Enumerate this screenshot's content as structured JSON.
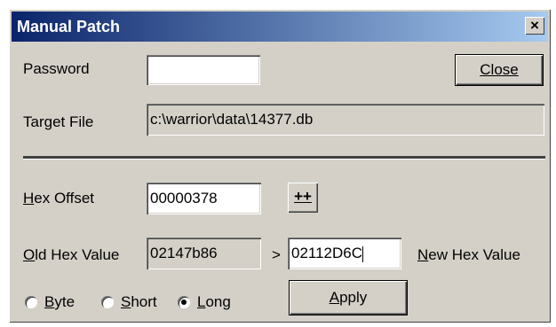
{
  "window": {
    "title": "Manual Patch",
    "close_glyph": "×"
  },
  "password": {
    "label": "Password",
    "value": ""
  },
  "close_button": {
    "label": "Close"
  },
  "target_file": {
    "label": "Target File",
    "value": "c:\\warrior\\data\\14377.db"
  },
  "hex_offset": {
    "label_first": "H",
    "label_rest": "ex Offset",
    "value": "00000378"
  },
  "increment_button": {
    "label": "++"
  },
  "old_hex": {
    "label_first": "O",
    "label_rest": "ld Hex Value",
    "value": "02147b86"
  },
  "arrow": ">",
  "new_hex": {
    "value": "02112D6C",
    "label_first": "N",
    "label_rest": "ew Hex Value"
  },
  "size_options": [
    {
      "first": "B",
      "rest": "yte",
      "selected": false
    },
    {
      "first": "S",
      "rest": "hort",
      "selected": false
    },
    {
      "first": "L",
      "rest": "ong",
      "selected": true
    }
  ],
  "apply_button": {
    "first": "A",
    "rest": "pply"
  }
}
